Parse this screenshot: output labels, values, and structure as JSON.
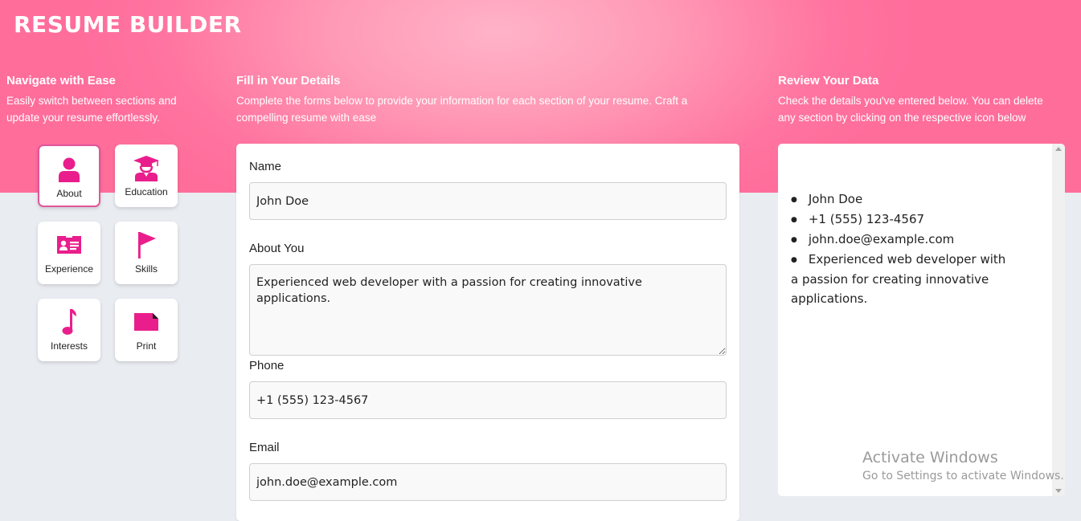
{
  "app": {
    "title": "RESUME BUILDER"
  },
  "colors": {
    "accent": "#e91e8c",
    "hero": "#ff8fb0",
    "active_border": "#e0569a"
  },
  "nav": {
    "heading": "Navigate with Ease",
    "description": "Easily switch between sections and update your resume effortlessly.",
    "tiles": [
      {
        "label": "About",
        "icon": "person-icon",
        "active": true
      },
      {
        "label": "Education",
        "icon": "graduate-icon",
        "active": false
      },
      {
        "label": "Experience",
        "icon": "id-card-icon",
        "active": false
      },
      {
        "label": "Skills",
        "icon": "flag-icon",
        "active": false
      },
      {
        "label": "Interests",
        "icon": "music-note-icon",
        "active": false
      },
      {
        "label": "Print",
        "icon": "document-icon",
        "active": false
      }
    ]
  },
  "form": {
    "heading": "Fill in Your Details",
    "description": "Complete the forms below to provide your information for each section of your resume. Craft a compelling resume with ease",
    "fields": {
      "name": {
        "label": "Name",
        "value": "John Doe"
      },
      "about": {
        "label": "About You",
        "value": "Experienced web developer with a passion for creating innovative applications."
      },
      "phone": {
        "label": "Phone",
        "value": "+1 (555) 123-4567"
      },
      "email": {
        "label": "Email",
        "value": "john.doe@example.com"
      }
    }
  },
  "review": {
    "heading": "Review Your Data",
    "description": "Check the details you've entered below. You can delete any section by clicking on the respective icon below",
    "items": [
      "John Doe",
      "+1 (555) 123-4567",
      "john.doe@example.com",
      "Experienced web developer with a passion for creating innovative applications."
    ]
  },
  "watermark": {
    "title": "Activate Windows",
    "subtitle": "Go to Settings to activate Windows."
  }
}
